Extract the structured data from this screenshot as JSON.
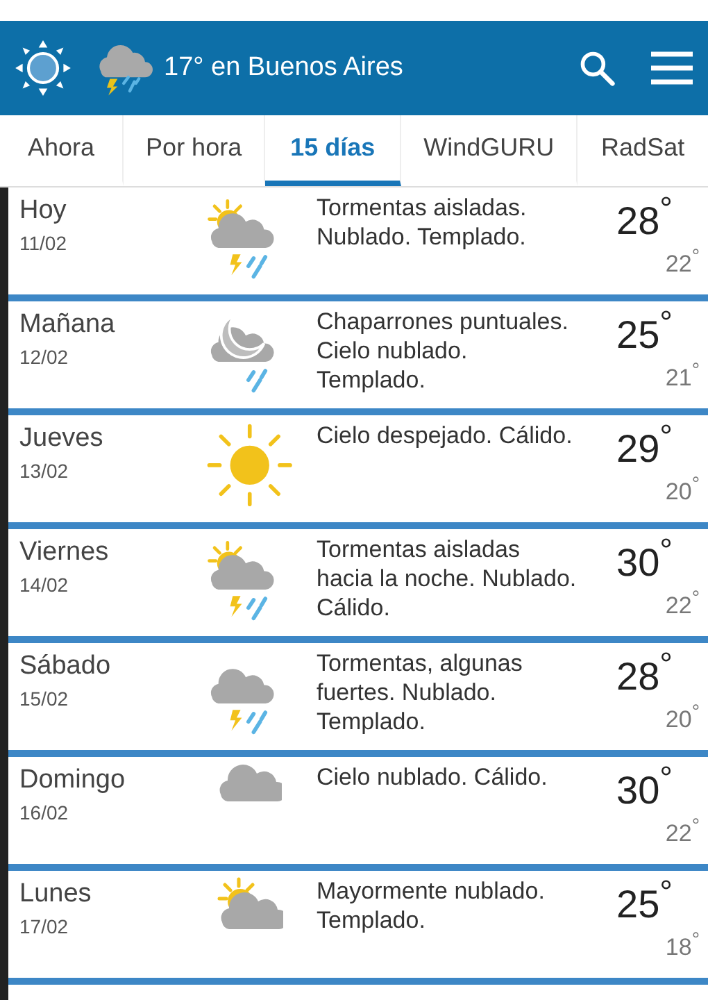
{
  "header": {
    "title": "17° en Buenos Aires"
  },
  "tabs": [
    {
      "label": "Ahora",
      "selected": false
    },
    {
      "label": "Por hora",
      "selected": false
    },
    {
      "label": "15 días",
      "selected": true
    },
    {
      "label": "WindGURU",
      "selected": false
    },
    {
      "label": "RadSat",
      "selected": false
    }
  ],
  "days": [
    {
      "day": "Hoy",
      "date": "11/02",
      "kind": "sun-cloud-storm",
      "description": "Tormentas aisladas. Nublado. Templado.",
      "high": "28$^{°}$",
      "low": "22$^{°}$"
    },
    {
      "day": "Mañana",
      "date": "12/02",
      "kind": "moon-cloud-rain",
      "description": "Chaparrones puntuales. Cielo nublado. Templado.",
      "high": "25$^{°}$",
      "low": "21$^{°}$"
    },
    {
      "day": "Jueves",
      "date": "13/02",
      "kind": "sun",
      "description": "Cielo despejado. Cálido.",
      "high": "29$^{°}$",
      "low": "20$^{°}$"
    },
    {
      "day": "Viernes",
      "date": "14/02",
      "kind": "sun-cloud-storm",
      "description": "Tormentas aisladas hacia la noche. Nublado. Cálido.",
      "high": "30$^{°}$",
      "low": "22$^{°}$"
    },
    {
      "day": "Sábado",
      "date": "15/02",
      "kind": "cloud-storm",
      "description": "Tormentas, algunas fuertes. Nublado. Templado.",
      "high": "28$^{°}$",
      "low": "20$^{°}$"
    },
    {
      "day": "Domingo",
      "date": "16/02",
      "kind": "cloud",
      "description": "Cielo nublado. Cálido.",
      "high": "30$^{°}$",
      "low": "22$^{°}$"
    },
    {
      "day": "Lunes",
      "date": "17/02",
      "kind": "sun-cloud",
      "description": "Mayormente nublado. Templado.",
      "high": "25$^{°}$",
      "low": "18$^{°}$"
    }
  ]
}
